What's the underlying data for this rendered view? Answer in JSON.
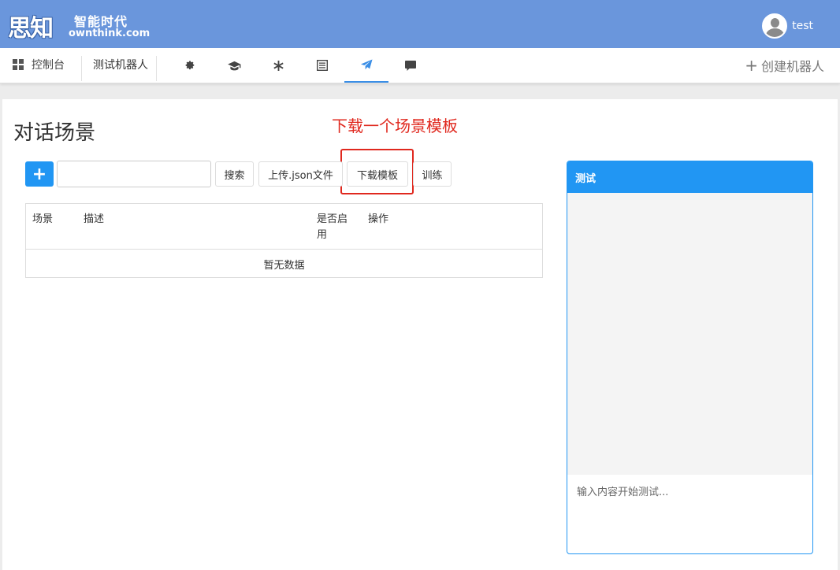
{
  "header": {
    "logo_cn": "思知",
    "logo_tagline": "智能时代",
    "logo_url": "ownthink.com",
    "username": "test"
  },
  "nav": {
    "dashboard_label": "控制台",
    "bot_name": "测试机器人",
    "icons": [
      "gear-icon",
      "graduation-cap-icon",
      "asterisk-icon",
      "list-icon",
      "paper-plane-icon",
      "comment-icon"
    ],
    "active_icon": "paper-plane-icon",
    "create_label": "创建机器人"
  },
  "main": {
    "title": "对话场景",
    "annotation": "下载一个场景模板",
    "add_button": "+",
    "search_value": "",
    "search_button": "搜索",
    "upload_button": "上传.json文件",
    "download_button": "下载模板",
    "train_button": "训练",
    "table": {
      "columns": [
        "场景",
        "描述",
        "是否启用",
        "操作"
      ],
      "empty_text": "暂无数据"
    }
  },
  "test_panel": {
    "title": "测试",
    "input_placeholder": "输入内容开始测试..."
  },
  "colors": {
    "header_bg": "#6a96dc",
    "accent": "#2196f3",
    "annotation": "#e0281e"
  }
}
